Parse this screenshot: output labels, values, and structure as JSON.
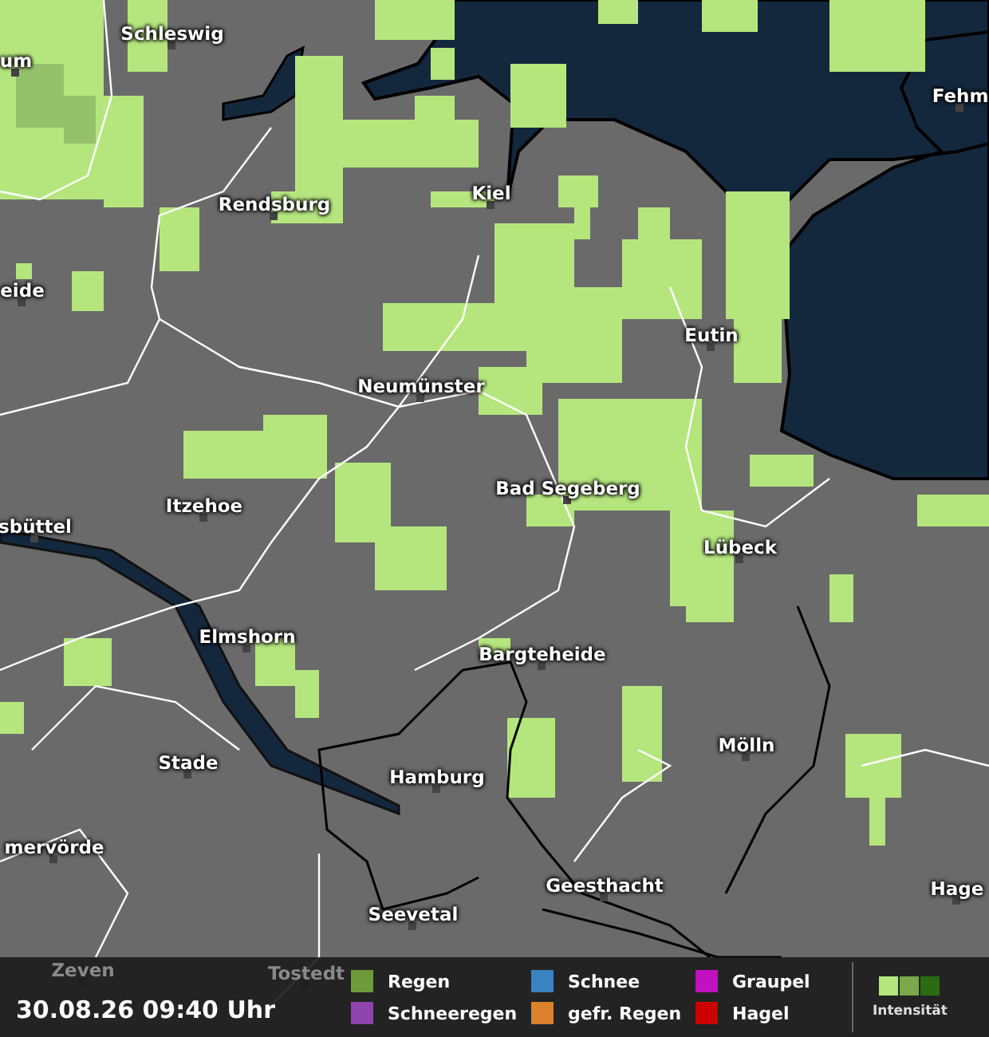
{
  "map": {
    "cities": [
      {
        "name": "Schleswig"
      },
      {
        "name": "um"
      },
      {
        "name": "Fehm"
      },
      {
        "name": "Rendsburg"
      },
      {
        "name": "Kiel"
      },
      {
        "name": "eide"
      },
      {
        "name": "Eutin"
      },
      {
        "name": "Neumünster"
      },
      {
        "name": "Bad Segeberg"
      },
      {
        "name": "Itzehoe"
      },
      {
        "name": "sbüttel"
      },
      {
        "name": "Lübeck"
      },
      {
        "name": "Elmshorn"
      },
      {
        "name": "Bargteheide"
      },
      {
        "name": "Mölln"
      },
      {
        "name": "Stade"
      },
      {
        "name": "Hamburg"
      },
      {
        "name": "mervörde"
      },
      {
        "name": "Geesthacht"
      },
      {
        "name": "Hage"
      },
      {
        "name": "Seevetal"
      },
      {
        "name": "Zeven"
      },
      {
        "name": "Tostedt"
      }
    ]
  },
  "legend": {
    "timestamp": "30.08.26 09:40 Uhr",
    "types": [
      {
        "label": "Regen",
        "color": "#6e9a3a"
      },
      {
        "label": "Schnee",
        "color": "#3b83c0"
      },
      {
        "label": "Graupel",
        "color": "#c010c0"
      },
      {
        "label": "Schneeregen",
        "color": "#8e44ad"
      },
      {
        "label": "gefr. Regen",
        "color": "#d9822b"
      },
      {
        "label": "Hagel",
        "color": "#cc0000"
      }
    ],
    "intensity": {
      "label": "Intensität",
      "steps": [
        {
          "color": "#b5e67e"
        },
        {
          "color": "#7aa84a"
        },
        {
          "color": "#2d6b12"
        }
      ]
    }
  }
}
